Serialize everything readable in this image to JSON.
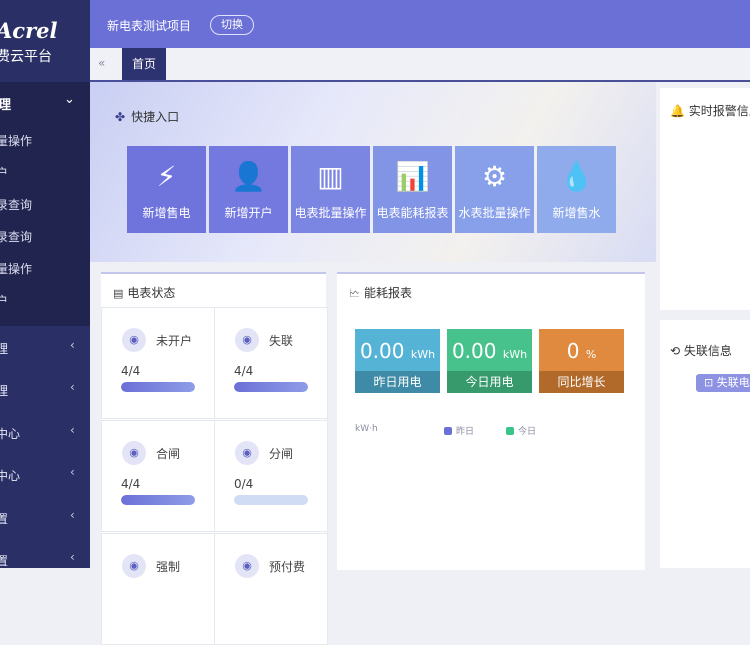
{
  "brand": {
    "logo": "Acrel",
    "subtitle": "费云平台"
  },
  "sidebar": {
    "open_group": {
      "label": "理",
      "chevron": "⌄"
    },
    "sub_items": [
      "量操作",
      "户",
      "录查询",
      "录查询",
      "量操作",
      "户"
    ],
    "items": [
      {
        "label": "理",
        "chevron": "‹"
      },
      {
        "label": "理",
        "chevron": "‹"
      },
      {
        "label": "中心",
        "chevron": "‹"
      },
      {
        "label": "中心",
        "chevron": "‹"
      },
      {
        "label": "置",
        "chevron": "‹"
      },
      {
        "label": "置",
        "chevron": "‹"
      }
    ]
  },
  "topbar": {
    "project": "新电表测试项目",
    "switch_label": "切换"
  },
  "tabs": {
    "back_icon": "«",
    "home": "首页"
  },
  "quick": {
    "title": "快捷入口",
    "tiles": [
      {
        "label": "新增售电",
        "icon": "card-bolt-icon",
        "glyph": "⚡",
        "color": "#6f73dc"
      },
      {
        "label": "新增开户",
        "icon": "add-user-icon",
        "glyph": "👤",
        "color": "#7379de"
      },
      {
        "label": "电表批量操作",
        "icon": "meter-batch-icon",
        "glyph": "▥",
        "color": "#7b86e2"
      },
      {
        "label": "电表能耗报表",
        "icon": "energy-report-icon",
        "glyph": "📊",
        "color": "#8194e6"
      },
      {
        "label": "水表批量操作",
        "icon": "water-batch-icon",
        "glyph": "⚙",
        "color": "#889fe9"
      },
      {
        "label": "新增售水",
        "icon": "water-drop-icon",
        "glyph": "💧",
        "color": "#8fabec"
      }
    ]
  },
  "meter_status": {
    "title": "电表状态",
    "items": [
      {
        "label": "未开户",
        "value": "4/4",
        "progress": 1.0,
        "icon": "meter-icon"
      },
      {
        "label": "失联",
        "value": "4/4",
        "progress": 1.0,
        "icon": "disconnect-icon"
      },
      {
        "label": "合闸",
        "value": "4/4",
        "progress": 1.0,
        "icon": "switch-on-icon"
      },
      {
        "label": "分闸",
        "value": "0/4",
        "progress": 0.0,
        "icon": "switch-off-icon"
      },
      {
        "label": "强制",
        "value": "",
        "progress": 0.0,
        "icon": "force-icon"
      },
      {
        "label": "预付费",
        "value": "",
        "progress": 0.0,
        "icon": "prepaid-icon"
      }
    ]
  },
  "energy_report": {
    "title": "能耗报表",
    "metrics": [
      {
        "value": "0.00",
        "unit": "kWh",
        "label": "昨日用电",
        "color": "#55b3d6",
        "label_color": "#3f8aa6"
      },
      {
        "value": "0.00",
        "unit": "kWh",
        "label": "今日用电",
        "color": "#47c28c",
        "label_color": "#379a6c"
      },
      {
        "value": "0",
        "unit": "%",
        "label": "同比增长",
        "color": "#df8a3e",
        "label_color": "#b26a2b"
      }
    ],
    "unit_label": "kW·h",
    "legend": [
      {
        "name": "昨日",
        "color": "#6b70d6"
      },
      {
        "name": "今日",
        "color": "#3ac48a"
      }
    ]
  },
  "right_panels": {
    "alarm_title": "实时报警信息",
    "lost_title": "失联信息",
    "lost_badge": "⊡ 失联电"
  }
}
